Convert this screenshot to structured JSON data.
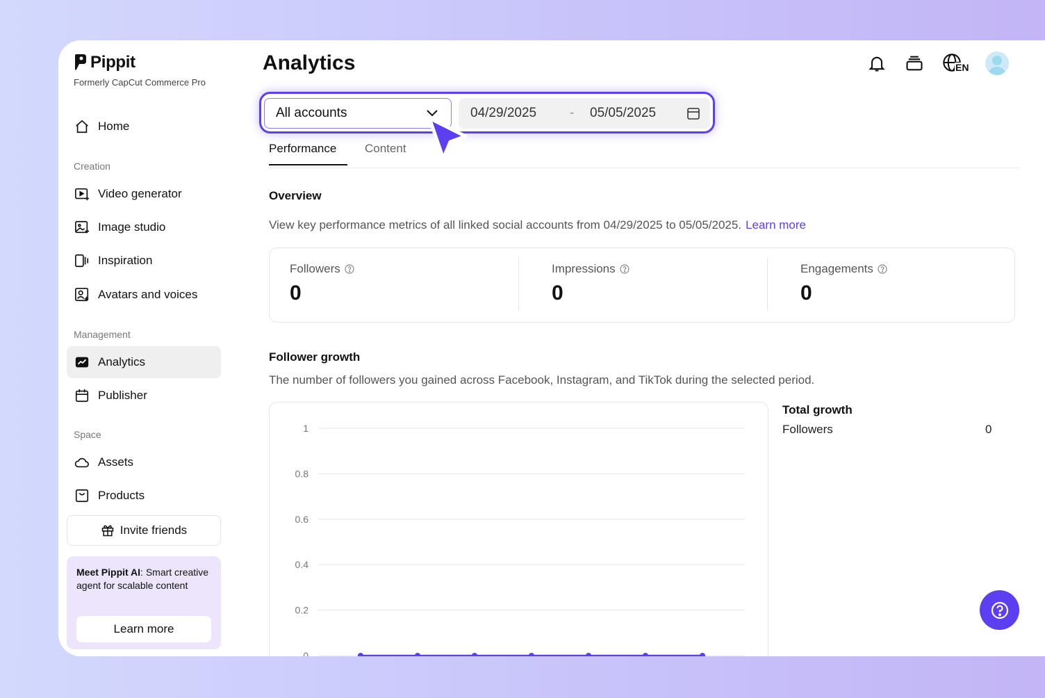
{
  "app": {
    "brand": "Pippit",
    "brand_sub": "Formerly CapCut Commerce Pro",
    "accent_color": "#5b3ff0"
  },
  "sidebar": {
    "home": "Home",
    "sections": {
      "creation": "Creation",
      "management": "Management",
      "space": "Space"
    },
    "creation_items": [
      {
        "label": "Video generator",
        "icon": "video-generator-icon"
      },
      {
        "label": "Image studio",
        "icon": "image-studio-icon"
      },
      {
        "label": "Inspiration",
        "icon": "inspiration-icon"
      },
      {
        "label": "Avatars and voices",
        "icon": "avatar-voice-icon"
      }
    ],
    "management_items": [
      {
        "label": "Analytics",
        "icon": "analytics-icon",
        "active": true
      },
      {
        "label": "Publisher",
        "icon": "calendar-icon"
      }
    ],
    "space_items": [
      {
        "label": "Assets",
        "icon": "cloud-icon"
      },
      {
        "label": "Products",
        "icon": "bag-icon"
      }
    ],
    "invite": "Invite friends",
    "promo": {
      "bold": "Meet Pippit AI",
      "text": ": Smart creative agent for scalable content",
      "button": "Learn more"
    }
  },
  "header": {
    "title": "Analytics",
    "language": "EN"
  },
  "filters": {
    "account": "All accounts",
    "date_from": "04/29/2025",
    "separator": "-",
    "date_to": "05/05/2025"
  },
  "tabs": [
    "Performance",
    "Content"
  ],
  "overview": {
    "title": "Overview",
    "description": "View key performance metrics of all linked social accounts from 04/29/2025 to 05/05/2025.",
    "learn_more": "Learn more",
    "metrics": [
      {
        "label": "Followers",
        "value": "0"
      },
      {
        "label": "Impressions",
        "value": "0"
      },
      {
        "label": "Engagements",
        "value": "0"
      }
    ]
  },
  "follower_growth": {
    "title": "Follower growth",
    "description": "The number of followers you gained across Facebook, Instagram, and TikTok during the selected period.",
    "total_title": "Total growth",
    "total_label": "Followers",
    "total_value": "0"
  },
  "chart_data": {
    "type": "line",
    "title": "",
    "xlabel": "",
    "ylabel": "",
    "ylim": [
      0,
      1
    ],
    "yticks": [
      "1",
      "0.8",
      "0.6",
      "0.4",
      "0.2",
      "0"
    ],
    "series": [
      {
        "values": [
          0,
          0,
          0,
          0,
          0,
          0,
          0
        ],
        "color": "#5b3ff0"
      }
    ],
    "grid": true
  }
}
